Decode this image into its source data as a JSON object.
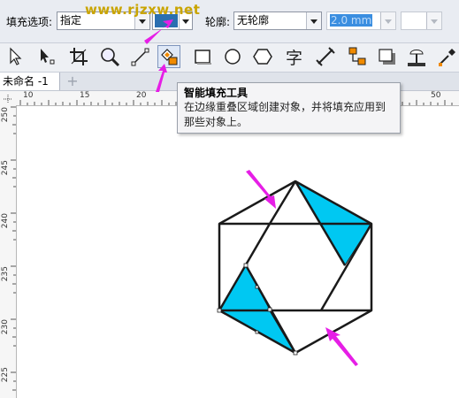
{
  "property_bar": {
    "fill_option_label": "填充选项:",
    "fill_option_value": "指定",
    "fill_color": "#2a6fb0",
    "outline_label": "轮廓:",
    "outline_value": "无轮廓",
    "outline_width": "2.0 mm"
  },
  "watermark": "www.rjzxw.net",
  "toolbar": {
    "tools": [
      "pick-tool-icon",
      "shape-tool-icon",
      "crop-tool-icon",
      "zoom-tool-icon",
      "freehand-tool-icon",
      "smart-fill-tool-icon",
      "rectangle-tool-icon",
      "ellipse-tool-icon",
      "polygon-tool-icon",
      "text-tool-icon",
      "dimension-tool-icon",
      "connector-tool-icon",
      "drop-shadow-tool-icon",
      "transparency-tool-icon",
      "eyedropper-tool-icon"
    ],
    "active_tool": "smart-fill-tool-icon"
  },
  "document_tab": {
    "title": "未命名 -1",
    "add": "+"
  },
  "ruler": {
    "h_ticks": [
      "10",
      "15",
      "20",
      "50"
    ],
    "v_ticks": [
      "250",
      "245",
      "240",
      "235",
      "230",
      "225"
    ]
  },
  "tooltip": {
    "title": "智能填充工具",
    "description": "在边缘重叠区域创建对象，并将填充应用到那些对象上。"
  },
  "colors": {
    "fill_cyan": "#00c8f2",
    "arrow_magenta": "#e61ee6",
    "outline": "#1a1a1a"
  }
}
